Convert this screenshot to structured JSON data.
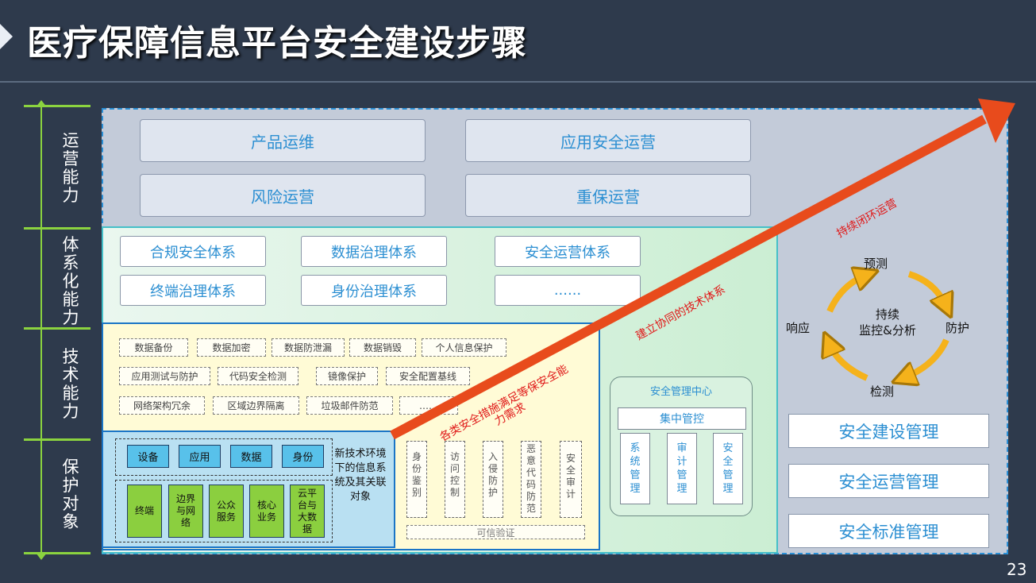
{
  "title": "医疗保障信息平台安全建设步骤",
  "page_number": "23",
  "axis": {
    "operations": "运\n营\n能\n力",
    "systematic": "体\n系\n化\n能\n力",
    "technical": "技\n术\n能\n力",
    "protection": "保\n护\n对\n象"
  },
  "operations": {
    "items": [
      "产品运维",
      "应用安全运营",
      "风险运营",
      "重保运营"
    ]
  },
  "systems": {
    "items": [
      "合规安全体系",
      "数据治理体系",
      "安全运营体系",
      "终端治理体系",
      "身份治理体系",
      "......"
    ]
  },
  "technical": {
    "row1": [
      "数据备份",
      "数据加密",
      "数据防泄漏",
      "数据销毁",
      "个人信息保护"
    ],
    "row2": [
      "应用测试与防护",
      "代码安全检测",
      "镜像保护",
      "安全配置基线"
    ],
    "row3": [
      "网络架构冗余",
      "区域边界隔离",
      "垃圾邮件防范",
      "……"
    ]
  },
  "protection": {
    "blue_items": [
      "设备",
      "应用",
      "数据",
      "身份"
    ],
    "green_items": [
      "终端",
      "边界\n与网\n络",
      "公众\n服务",
      "核心\n业务",
      "云平\n台与\n大数\n据"
    ],
    "caption": "新技术环境下的信息系统及其关联对象"
  },
  "controls": {
    "items": [
      "身\n份\n鉴\n别",
      "访\n问\n控\n制",
      "入\n侵\n防\n护",
      "恶\n意\n代\n码\n防\n范",
      "安\n全\n审\n计"
    ],
    "trusted": "可信验证"
  },
  "mgmt_center": {
    "title": "安全管理中心",
    "central": "集中管控",
    "subs": [
      "系\n统\n管\n理",
      "审\n计\n管\n理",
      "安\n全\n管\n理"
    ]
  },
  "cycle": {
    "top": "预测",
    "right": "防护",
    "bottom": "检测",
    "left": "响应",
    "center": "持续\n监控&分析"
  },
  "management": {
    "items": [
      "安全建设管理",
      "安全运营管理",
      "安全标准管理"
    ]
  },
  "arrow_labels": {
    "first": "各类安全措施满足等保安全能力需求",
    "second": "建立协同的技术体系",
    "third": "持续闭环运营"
  },
  "colors": {
    "axis": "#8bd33f",
    "arrow": "#e84b1c",
    "cycle_arrow": "#f5b21b",
    "accent_text": "#2c8fd2"
  }
}
